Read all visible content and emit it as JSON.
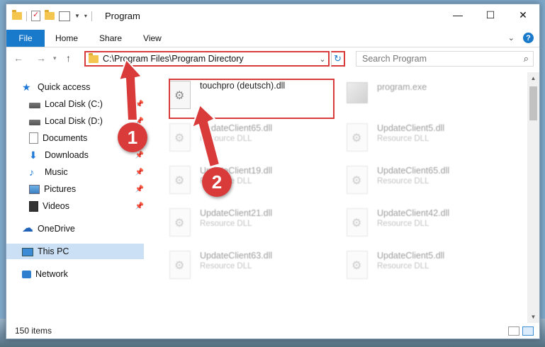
{
  "window": {
    "title": "Program",
    "controls": {
      "minimize": "—",
      "maximize": "☐",
      "close": "✕"
    }
  },
  "ribbon": {
    "file_tab": "File",
    "tabs": [
      "Home",
      "Share",
      "View"
    ],
    "expand_icon": "chevron-down-icon",
    "help_label": "?"
  },
  "address_bar": {
    "path": "C:\\Program Files\\Program Directory"
  },
  "search": {
    "placeholder": "Search Program"
  },
  "sidebar": {
    "items": [
      {
        "label": "Quick access",
        "icon": "star-icon",
        "pinned": false
      },
      {
        "label": "Local Disk (C:)",
        "icon": "disk-icon",
        "pinned": true
      },
      {
        "label": "Local Disk (D:)",
        "icon": "disk-icon",
        "pinned": true
      },
      {
        "label": "Documents",
        "icon": "documents-icon",
        "pinned": true
      },
      {
        "label": "Downloads",
        "icon": "downloads-icon",
        "pinned": true
      },
      {
        "label": "Music",
        "icon": "music-icon",
        "pinned": true
      },
      {
        "label": "Pictures",
        "icon": "pictures-icon",
        "pinned": true
      },
      {
        "label": "Videos",
        "icon": "videos-icon",
        "pinned": true
      },
      {
        "label": "OneDrive",
        "icon": "onedrive-icon",
        "pinned": false
      },
      {
        "label": "This PC",
        "icon": "pc-icon",
        "pinned": false,
        "selected": true
      },
      {
        "label": "Network",
        "icon": "network-icon",
        "pinned": false
      }
    ]
  },
  "files": {
    "highlighted": {
      "name": "touchpro (deutsch).dll"
    },
    "exe": {
      "name": "program.exe"
    },
    "items": [
      {
        "name": "UpdateClient65.dll",
        "type": "Resource DLL"
      },
      {
        "name": "UpdateClient5.dll",
        "type": "Resource DLL"
      },
      {
        "name": "UpdateClient19.dll",
        "type": "Resource DLL"
      },
      {
        "name": "UpdateClient65.dll",
        "type": "Resource DLL"
      },
      {
        "name": "UpdateClient21.dll",
        "type": "Resource DLL"
      },
      {
        "name": "UpdateClient42.dll",
        "type": "Resource DLL"
      },
      {
        "name": "UpdateClient63.dll",
        "type": "Resource DLL"
      },
      {
        "name": "UpdateClient5.dll",
        "type": "Resource DLL"
      }
    ]
  },
  "status_bar": {
    "count": "150 items"
  },
  "callouts": {
    "step1": "1",
    "step2": "2",
    "color": "#d93b3b"
  }
}
